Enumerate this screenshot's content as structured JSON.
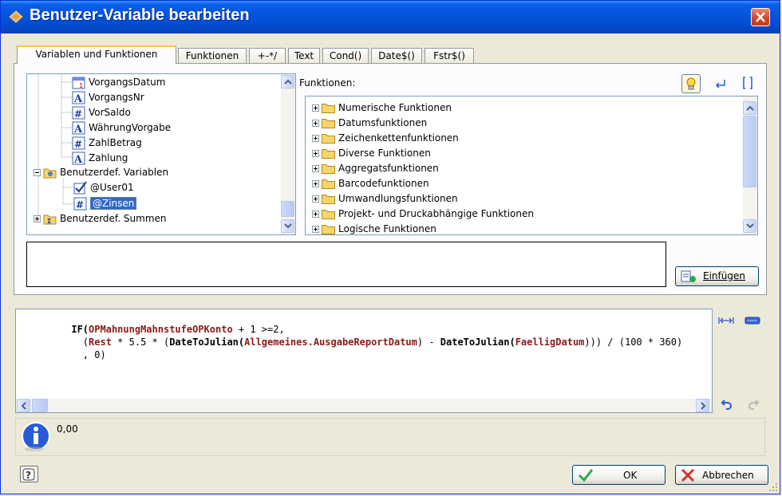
{
  "window": {
    "title": "Benutzer-Variable bearbeiten"
  },
  "tabs": [
    {
      "label": "Variablen und Funktionen",
      "active": true
    },
    {
      "label": "Funktionen",
      "active": false
    },
    {
      "label": "+-*/",
      "active": false
    },
    {
      "label": "Text",
      "active": false
    },
    {
      "label": "Cond()",
      "active": false
    },
    {
      "label": "Date$()",
      "active": false
    },
    {
      "label": "Fstr$()",
      "active": false
    }
  ],
  "var_tree": {
    "items": [
      {
        "label": "VorgangsDatum",
        "icon": "calendar-icon"
      },
      {
        "label": "VorgangsNr",
        "icon": "text-field-icon"
      },
      {
        "label": "VorSaldo",
        "icon": "number-field-icon"
      },
      {
        "label": "WährungVorgabe",
        "icon": "text-field-icon"
      },
      {
        "label": "ZahlBetrag",
        "icon": "number-field-icon"
      },
      {
        "label": "Zahlung",
        "icon": "text-field-icon"
      },
      {
        "label": "Benutzerdef. Variablen",
        "icon": "folder-icon"
      },
      {
        "label": "@User01",
        "icon": "checkbox-field-icon"
      },
      {
        "label": "@Zinsen",
        "icon": "number-field-icon",
        "selected": true
      },
      {
        "label": "Benutzerdef. Summen",
        "icon": "folder-icon"
      }
    ]
  },
  "functions": {
    "label": "Funktionen:",
    "items": [
      "Numerische Funktionen",
      "Datumsfunktionen",
      "Zeichenkettenfunktionen",
      "Diverse Funktionen",
      "Aggregatsfunktionen",
      "Barcodefunktionen",
      "Umwandlungsfunktionen",
      "Projekt- und Druckabhängige Funktionen",
      "Logische Funktionen"
    ]
  },
  "buttons": {
    "insert": "Einfügen",
    "ok": "OK",
    "cancel": "Abbrechen"
  },
  "expression": {
    "line1": [
      {
        "t": "IF(",
        "c": "fn"
      },
      {
        "t": "OPMahnungMahnstufeOPKonto",
        "c": "var"
      },
      {
        "t": " + 1 >=2,",
        "c": ""
      }
    ],
    "line2": [
      {
        "t": "  (",
        "c": ""
      },
      {
        "t": "Rest",
        "c": "var"
      },
      {
        "t": " * 5.5 * (",
        "c": ""
      },
      {
        "t": "DateToJulian(",
        "c": "fn"
      },
      {
        "t": "Allgemeines.AusgabeReportDatum",
        "c": "var"
      },
      {
        "t": ") - ",
        "c": ""
      },
      {
        "t": "DateToJulian(",
        "c": "fn"
      },
      {
        "t": "FaelligDatum",
        "c": "var"
      },
      {
        "t": "))) / (100 * 360)",
        "c": ""
      }
    ],
    "line3": [
      {
        "t": "  , 0)",
        "c": ""
      }
    ]
  },
  "result": {
    "value": "0,00"
  },
  "colors": {
    "accent": "#0a5de8",
    "selection": "#316ac5",
    "variable": "#8b1a1a"
  }
}
